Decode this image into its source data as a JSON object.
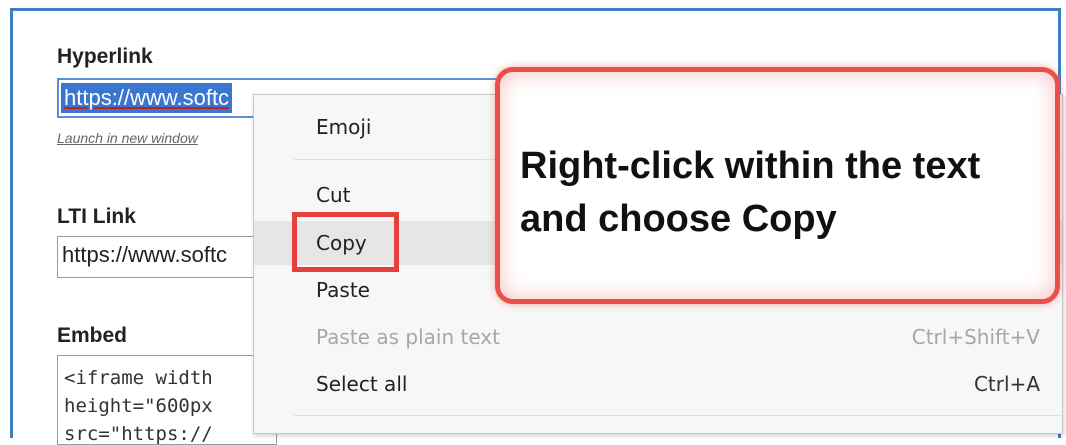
{
  "form": {
    "hyperlink_label": "Hyperlink",
    "hyperlink_value": "https://www.softc",
    "launch_link": "Launch in new window",
    "lti_label": "LTI Link",
    "lti_value": "https://www.softc",
    "embed_label": "Embed",
    "embed_lines": [
      "<iframe width",
      "height=\"600px",
      "src=\"https://"
    ]
  },
  "context_menu": {
    "items": [
      {
        "label": "Emoji",
        "shortcut": "",
        "disabled": false
      },
      {
        "label": "Cut",
        "shortcut": "",
        "disabled": false
      },
      {
        "label": "Copy",
        "shortcut": "",
        "disabled": false,
        "highlighted": true
      },
      {
        "label": "Paste",
        "shortcut": "",
        "disabled": false
      },
      {
        "label": "Paste as plain text",
        "shortcut": "Ctrl+Shift+V",
        "disabled": true
      },
      {
        "label": "Select all",
        "shortcut": "Ctrl+A",
        "disabled": false
      }
    ]
  },
  "callout": {
    "text_line1": "Right-click within the text",
    "text_line2": "and choose Copy",
    "border_color": "#e9504a"
  },
  "colors": {
    "frame": "#3b7fc4",
    "selection": "#3a75d0",
    "highlight_box": "#e4403c"
  }
}
